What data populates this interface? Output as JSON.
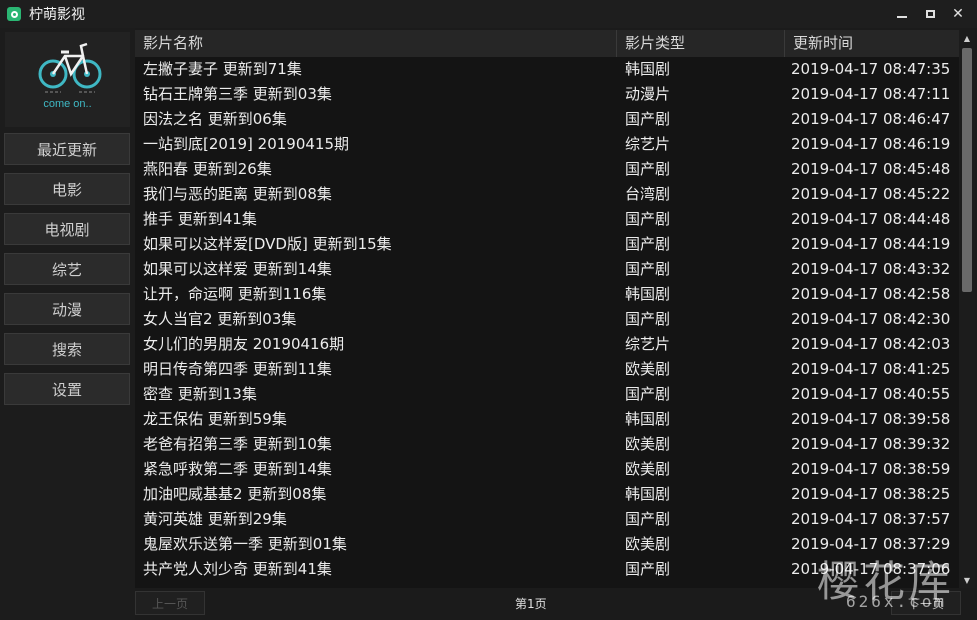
{
  "app": {
    "title": "柠萌影视"
  },
  "logo": {
    "text": "come on.."
  },
  "sidebar": {
    "items": [
      {
        "label": "最近更新"
      },
      {
        "label": "电影"
      },
      {
        "label": "电视剧"
      },
      {
        "label": "综艺"
      },
      {
        "label": "动漫"
      },
      {
        "label": "搜索"
      },
      {
        "label": "设置"
      }
    ]
  },
  "table": {
    "headers": [
      "影片名称",
      "影片类型",
      "更新时间"
    ],
    "rows": [
      [
        "左撇子妻子 更新到71集",
        "韩国剧",
        "2019-04-17 08:47:35"
      ],
      [
        "钻石王牌第三季 更新到03集",
        "动漫片",
        "2019-04-17 08:47:11"
      ],
      [
        "因法之名 更新到06集",
        "国产剧",
        "2019-04-17 08:46:47"
      ],
      [
        "一站到底[2019] 20190415期",
        "综艺片",
        "2019-04-17 08:46:19"
      ],
      [
        "燕阳春 更新到26集",
        "国产剧",
        "2019-04-17 08:45:48"
      ],
      [
        "我们与恶的距离 更新到08集",
        "台湾剧",
        "2019-04-17 08:45:22"
      ],
      [
        "推手 更新到41集",
        "国产剧",
        "2019-04-17 08:44:48"
      ],
      [
        "如果可以这样爱[DVD版] 更新到15集",
        "国产剧",
        "2019-04-17 08:44:19"
      ],
      [
        "如果可以这样爱 更新到14集",
        "国产剧",
        "2019-04-17 08:43:32"
      ],
      [
        "让开，命运啊 更新到116集",
        "韩国剧",
        "2019-04-17 08:42:58"
      ],
      [
        "女人当官2 更新到03集",
        "国产剧",
        "2019-04-17 08:42:30"
      ],
      [
        "女儿们的男朋友 20190416期",
        "综艺片",
        "2019-04-17 08:42:03"
      ],
      [
        "明日传奇第四季 更新到11集",
        "欧美剧",
        "2019-04-17 08:41:25"
      ],
      [
        "密查 更新到13集",
        "国产剧",
        "2019-04-17 08:40:55"
      ],
      [
        "龙王保佑 更新到59集",
        "韩国剧",
        "2019-04-17 08:39:58"
      ],
      [
        "老爸有招第三季 更新到10集",
        "欧美剧",
        "2019-04-17 08:39:32"
      ],
      [
        "紧急呼救第二季 更新到14集",
        "欧美剧",
        "2019-04-17 08:38:59"
      ],
      [
        "加油吧威基基2 更新到08集",
        "韩国剧",
        "2019-04-17 08:38:25"
      ],
      [
        "黄河英雄 更新到29集",
        "国产剧",
        "2019-04-17 08:37:57"
      ],
      [
        "鬼屋欢乐送第一季 更新到01集",
        "欧美剧",
        "2019-04-17 08:37:29"
      ],
      [
        "共产党人刘少奇 更新到41集",
        "国产剧",
        "2019-04-17 08:37:06"
      ]
    ]
  },
  "footer": {
    "prev_label": "上一页",
    "page_label": "第1页",
    "next_label": "下一页"
  },
  "watermark": {
    "main": "樱花库",
    "sub": "626x.com"
  },
  "colors": {
    "accent": "#3fb8c4",
    "app_icon": "#2bb673"
  }
}
